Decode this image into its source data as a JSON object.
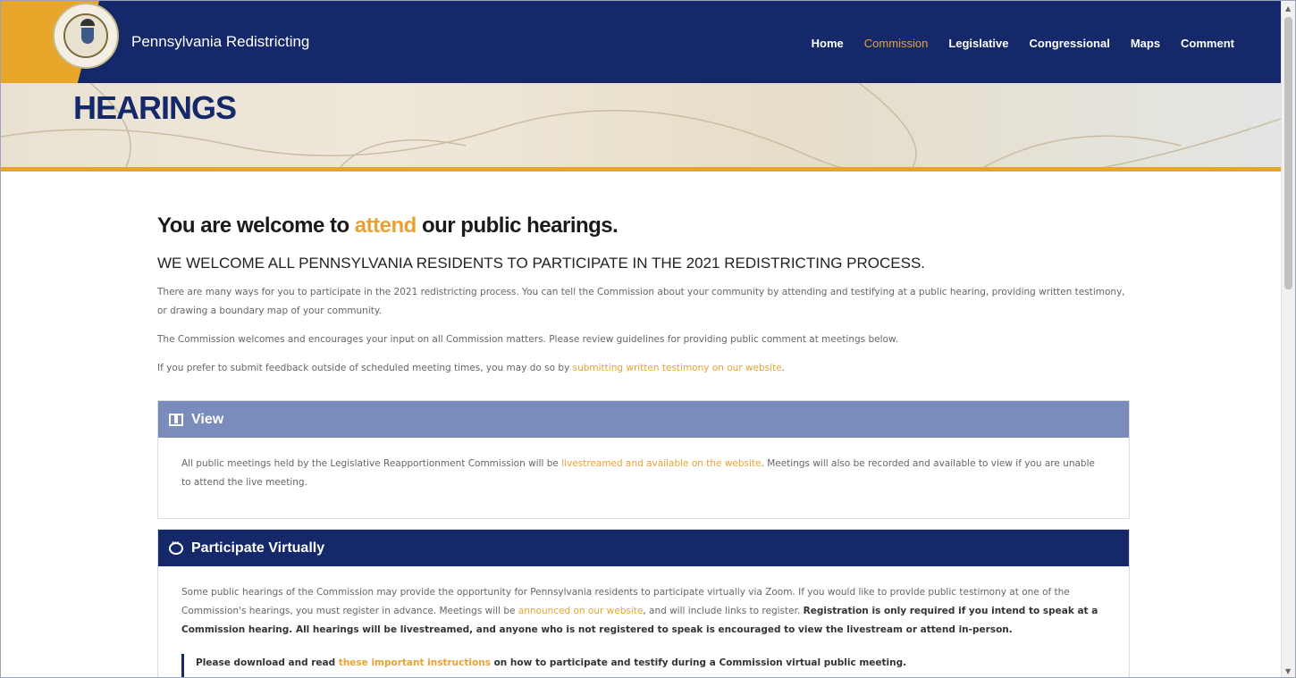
{
  "header": {
    "brand": "Pennsylvania Redistricting",
    "nav": [
      {
        "label": "Home"
      },
      {
        "label": "Commission",
        "active": true
      },
      {
        "label": "Legislative"
      },
      {
        "label": "Congressional"
      },
      {
        "label": "Maps"
      },
      {
        "label": "Comment"
      }
    ],
    "colors": {
      "navy": "#14286a",
      "gold": "#e7a62a"
    }
  },
  "banner": {
    "title": "HEARINGS"
  },
  "main": {
    "heading_pre": "You are welcome to ",
    "heading_accent": "attend",
    "heading_post": " our public hearings.",
    "subheading": "WE WELCOME ALL PENNSYLVANIA RESIDENTS TO PARTICIPATE IN THE 2021 REDISTRICTING PROCESS.",
    "para1": "There are many ways for you to participate in the 2021 redistricting process. You can tell the Commission about your community by attending and testifying at a public hearing, providing written testimony, or drawing a boundary map of your community.",
    "para2": "The Commission welcomes and encourages your input on all Commission matters. Please review guidelines for providing public comment at meetings below.",
    "para3_pre": "If you prefer to submit feedback outside of scheduled meeting times, you may do so by ",
    "para3_link": "submitting written testimony on our website",
    "para3_post": "."
  },
  "view_card": {
    "title": "View",
    "icon": "film-icon",
    "text_pre": "All public meetings held by the Legislative Reapportionment Commission will be ",
    "text_link": "livestreamed and available on the website",
    "text_post": ". Meetings will also be recorded and available to view if you are unable to attend the live meeting."
  },
  "virtual_card": {
    "title": "Participate Virtually",
    "icon": "chat-icon",
    "text_pre": "Some public hearings of the Commission may provide the opportunity for Pennsylvania residents to participate virtually via Zoom. If you would like to provide public testimony at one of the Commission's hearings, you must register in advance. Meetings will be ",
    "text_link": "announced on our website",
    "text_mid": ", and will include links to register. ",
    "text_bold": "Registration is only required if you intend to speak at a Commission hearing. All hearings will be livestreamed, and anyone who is not registered to speak is encouraged to view the livestream or attend in-person.",
    "quote_pre": "Please download and read ",
    "quote_link": "these important instructions",
    "quote_post": " on how to participate and testify during a Commission virtual public meeting."
  }
}
